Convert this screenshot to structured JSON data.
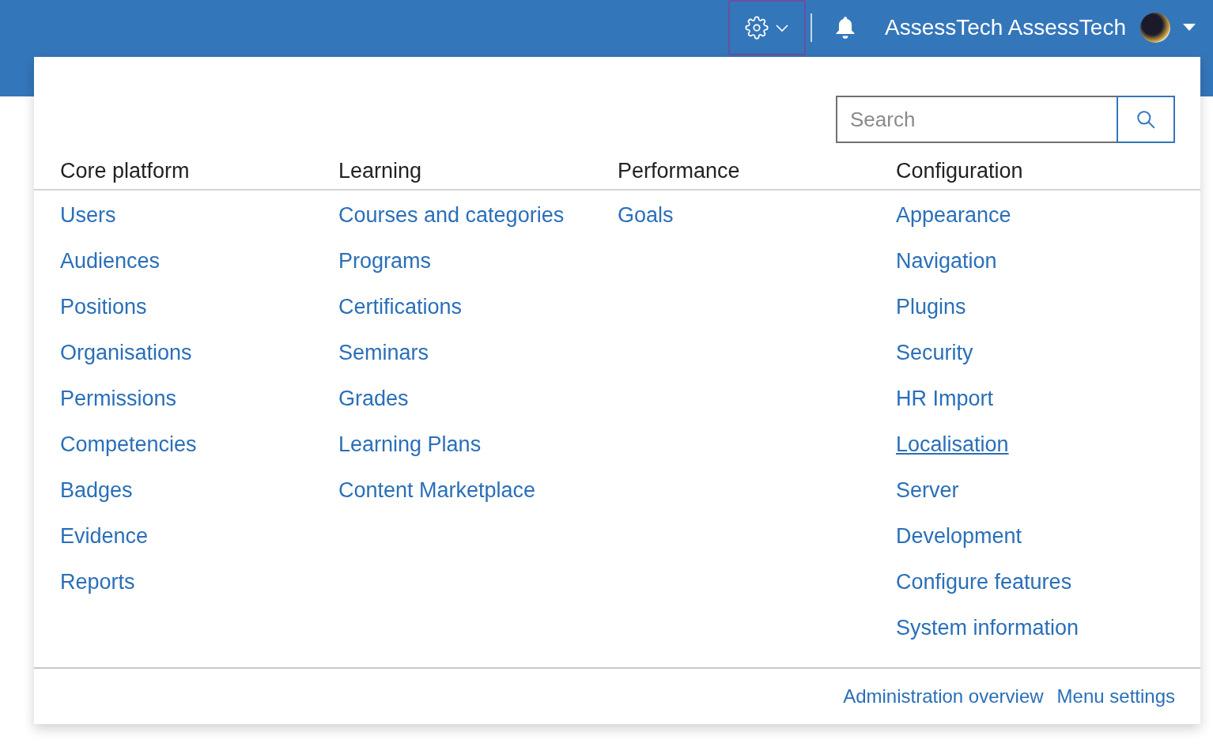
{
  "header": {
    "settings_menu": {
      "expanded": true
    },
    "user_name": "AssessTech AssessTech"
  },
  "admin_menu": {
    "search": {
      "placeholder": "Search"
    },
    "columns": [
      {
        "heading": "Core platform",
        "links": [
          {
            "label": "Users",
            "hovered": false
          },
          {
            "label": "Audiences",
            "hovered": false
          },
          {
            "label": "Positions",
            "hovered": false
          },
          {
            "label": "Organisations",
            "hovered": false
          },
          {
            "label": "Permissions",
            "hovered": false
          },
          {
            "label": "Competencies",
            "hovered": false
          },
          {
            "label": "Badges",
            "hovered": false
          },
          {
            "label": "Evidence",
            "hovered": false
          },
          {
            "label": "Reports",
            "hovered": false
          }
        ]
      },
      {
        "heading": "Learning",
        "links": [
          {
            "label": "Courses and categories",
            "hovered": false
          },
          {
            "label": "Programs",
            "hovered": false
          },
          {
            "label": "Certifications",
            "hovered": false
          },
          {
            "label": "Seminars",
            "hovered": false
          },
          {
            "label": "Grades",
            "hovered": false
          },
          {
            "label": "Learning Plans",
            "hovered": false
          },
          {
            "label": "Content Marketplace",
            "hovered": false
          }
        ]
      },
      {
        "heading": "Performance",
        "links": [
          {
            "label": "Goals",
            "hovered": false
          }
        ]
      },
      {
        "heading": "Configuration",
        "links": [
          {
            "label": "Appearance",
            "hovered": false
          },
          {
            "label": "Navigation",
            "hovered": false
          },
          {
            "label": "Plugins",
            "hovered": false
          },
          {
            "label": "Security",
            "hovered": false
          },
          {
            "label": "HR Import",
            "hovered": false
          },
          {
            "label": "Localisation",
            "hovered": true
          },
          {
            "label": "Server",
            "hovered": false
          },
          {
            "label": "Development",
            "hovered": false
          },
          {
            "label": "Configure features",
            "hovered": false
          },
          {
            "label": "System information",
            "hovered": false
          }
        ]
      }
    ],
    "footer_links": [
      "Administration overview",
      "Menu settings"
    ]
  }
}
